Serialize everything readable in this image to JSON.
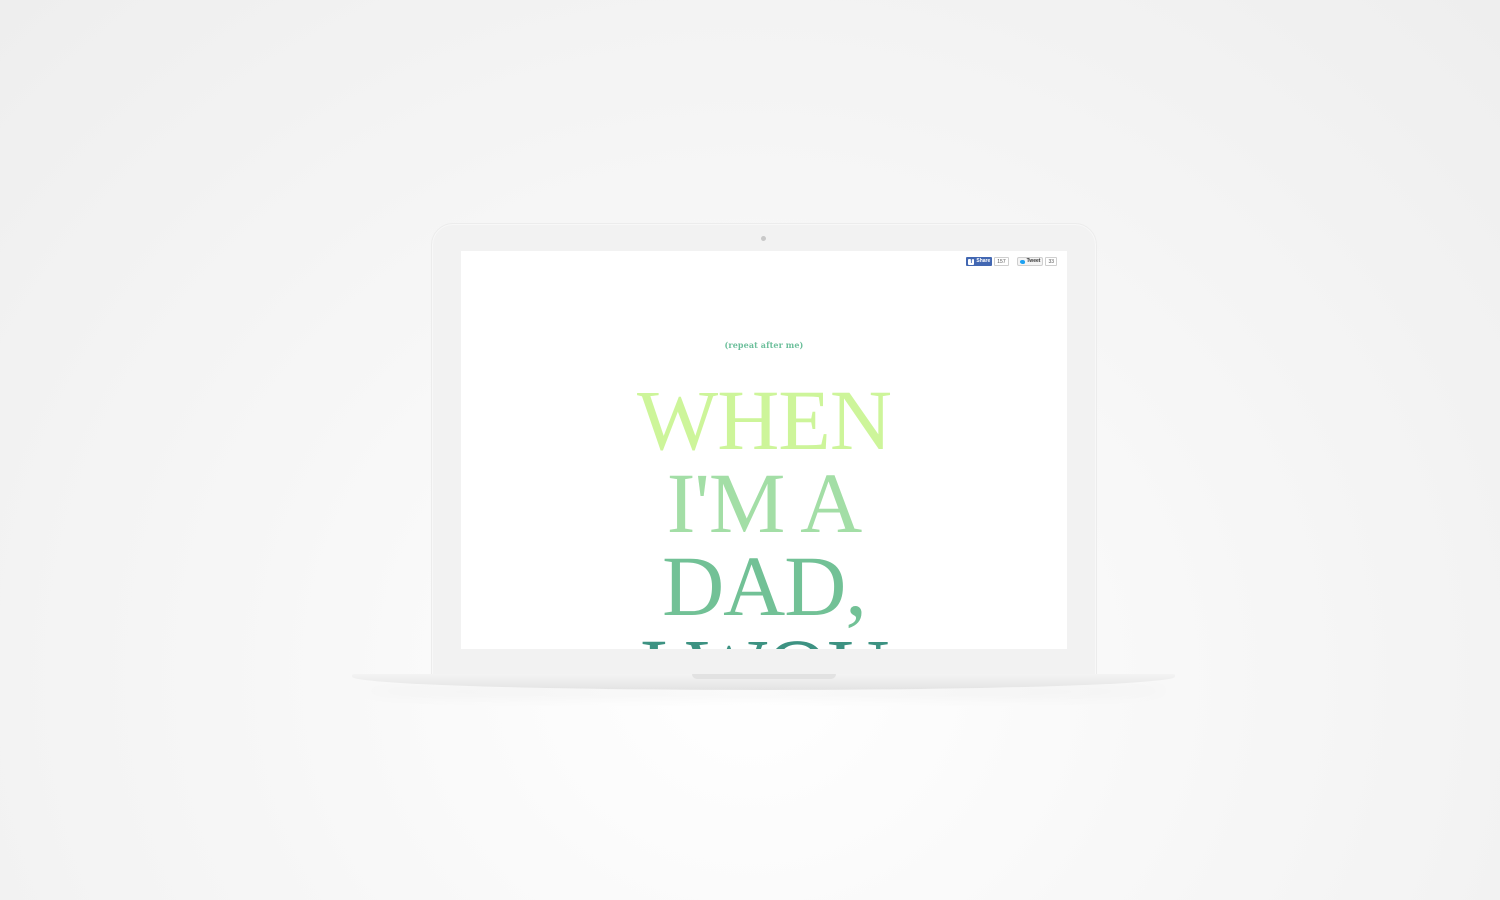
{
  "social": {
    "facebook": {
      "icon": "facebook-icon",
      "label": "Share",
      "count": "157"
    },
    "twitter": {
      "icon": "twitter-bird-icon",
      "label": "Tweet",
      "count": "33"
    }
  },
  "page": {
    "subtitle": "(repeat after me)",
    "headline_lines": [
      {
        "text": "WHEN",
        "color": "#cdf59a"
      },
      {
        "text": "I'M A",
        "color": "#a3dea6"
      },
      {
        "text": "DAD,",
        "color": "#72c196"
      },
      {
        "text": "I WOU",
        "color": "#3d9282"
      }
    ]
  },
  "colors": {
    "subtitle": "#6cbf9b",
    "facebook_blue": "#4267b2",
    "twitter_blue": "#1da1f2"
  }
}
